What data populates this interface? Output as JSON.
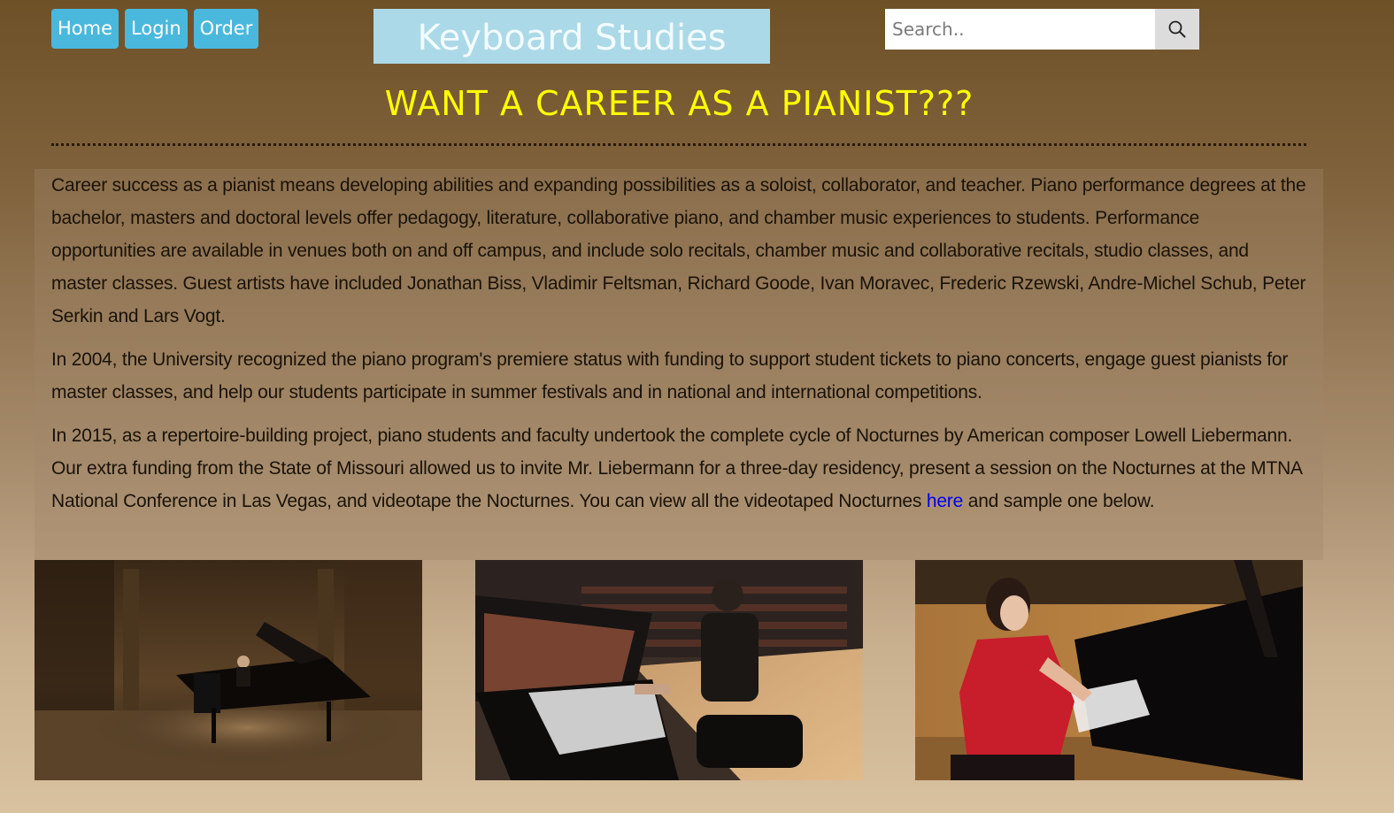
{
  "nav": {
    "home": "Home",
    "login": "Login",
    "order": "Order"
  },
  "brand": {
    "title": "Keyboard Studies"
  },
  "search": {
    "placeholder": "Search..",
    "icon": "search-icon"
  },
  "headline": "WANT A CAREER AS A PIANIST???",
  "content": {
    "paragraph1": "Career success as a pianist means developing abilities and expanding possibilities as a soloist, collaborator, and teacher. Piano performance degrees at the bachelor, masters and doctoral levels offer pedagogy, literature, collaborative piano, and chamber music experiences to students. Performance opportunities are available in venues both on and off campus, and include solo recitals, chamber music and collaborative recitals, studio classes, and master classes. Guest artists have included Jonathan Biss, Vladimir Feltsman, Richard Goode, Ivan Moravec, Frederic Rzewski, Andre-Michel Schub, Peter Serkin and Lars Vogt.",
    "paragraph2": "In 2004, the University recognized the piano program's premiere status with funding to support student tickets to piano concerts, engage guest pianists for master classes, and help our students participate in summer festivals and in national and international competitions.",
    "paragraph3_before_link": "In 2015, as a repertoire-building project, piano students and faculty undertook the complete cycle of Nocturnes by American composer Lowell Liebermann. Our extra funding from the State of Missouri allowed us to invite Mr. Liebermann for a three-day residency, present a session on the Nocturnes at the MTNA National Conference in Las Vegas, and videotape the Nocturnes. You can view all the videotaped Nocturnes ",
    "link_text": "here",
    "paragraph3_after_link": " and sample one below."
  },
  "photos": [
    {
      "name": "pianist-on-stage-photo"
    },
    {
      "name": "pianist-concert-hall-photo"
    },
    {
      "name": "pianist-red-dress-photo"
    }
  ],
  "colors": {
    "nav_button": "#4ab8dd",
    "brand_bg": "#acd9e7",
    "headline": "#ffff00",
    "link": "#0000ee"
  }
}
